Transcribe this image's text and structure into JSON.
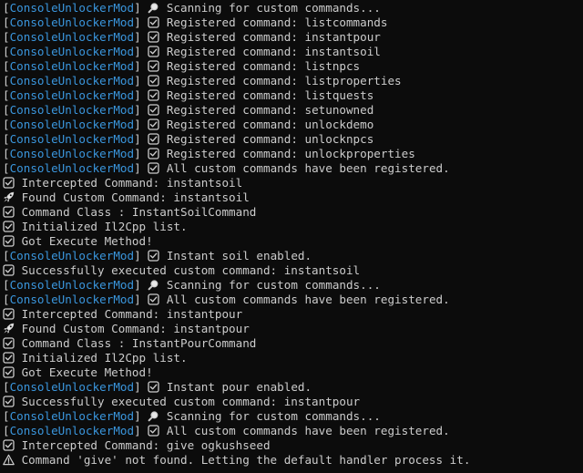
{
  "console": {
    "prefix": "ConsoleUnlockerMod",
    "colors": {
      "background": "#0c0c0c",
      "text": "#cccccc",
      "prefix": "#3a96dd"
    },
    "lines": [
      {
        "tagged": true,
        "icon": "magnifier-icon",
        "text": "Scanning for custom commands..."
      },
      {
        "tagged": true,
        "icon": "check-box-icon",
        "text": "Registered command: listcommands"
      },
      {
        "tagged": true,
        "icon": "check-box-icon",
        "text": "Registered command: instantpour"
      },
      {
        "tagged": true,
        "icon": "check-box-icon",
        "text": "Registered command: instantsoil"
      },
      {
        "tagged": true,
        "icon": "check-box-icon",
        "text": "Registered command: listnpcs"
      },
      {
        "tagged": true,
        "icon": "check-box-icon",
        "text": "Registered command: listproperties"
      },
      {
        "tagged": true,
        "icon": "check-box-icon",
        "text": "Registered command: listquests"
      },
      {
        "tagged": true,
        "icon": "check-box-icon",
        "text": "Registered command: setunowned"
      },
      {
        "tagged": true,
        "icon": "check-box-icon",
        "text": "Registered command: unlockdemo"
      },
      {
        "tagged": true,
        "icon": "check-box-icon",
        "text": "Registered command: unlocknpcs"
      },
      {
        "tagged": true,
        "icon": "check-box-icon",
        "text": "Registered command: unlockproperties"
      },
      {
        "tagged": true,
        "icon": "check-box-icon",
        "text": "All custom commands have been registered."
      },
      {
        "tagged": false,
        "icon": "check-box-icon",
        "text": "Intercepted Command: instantsoil"
      },
      {
        "tagged": false,
        "icon": "rocket-icon",
        "text": "Found Custom Command: instantsoil"
      },
      {
        "tagged": false,
        "icon": "check-box-icon",
        "text": "Command Class : InstantSoilCommand"
      },
      {
        "tagged": false,
        "icon": "check-box-icon",
        "text": "Initialized Il2Cpp list."
      },
      {
        "tagged": false,
        "icon": "check-box-icon",
        "text": "Got Execute Method!"
      },
      {
        "tagged": true,
        "icon": "check-box-icon",
        "text": "Instant soil enabled."
      },
      {
        "tagged": false,
        "icon": "check-box-icon",
        "text": "Successfully executed custom command: instantsoil"
      },
      {
        "tagged": true,
        "icon": "magnifier-icon",
        "text": "Scanning for custom commands..."
      },
      {
        "tagged": true,
        "icon": "check-box-icon",
        "text": "All custom commands have been registered."
      },
      {
        "tagged": false,
        "icon": "check-box-icon",
        "text": "Intercepted Command: instantpour"
      },
      {
        "tagged": false,
        "icon": "rocket-icon",
        "text": "Found Custom Command: instantpour"
      },
      {
        "tagged": false,
        "icon": "check-box-icon",
        "text": "Command Class : InstantPourCommand"
      },
      {
        "tagged": false,
        "icon": "check-box-icon",
        "text": "Initialized Il2Cpp list."
      },
      {
        "tagged": false,
        "icon": "check-box-icon",
        "text": "Got Execute Method!"
      },
      {
        "tagged": true,
        "icon": "check-box-icon",
        "text": "Instant pour enabled."
      },
      {
        "tagged": false,
        "icon": "check-box-icon",
        "text": "Successfully executed custom command: instantpour"
      },
      {
        "tagged": true,
        "icon": "magnifier-icon",
        "text": "Scanning for custom commands..."
      },
      {
        "tagged": true,
        "icon": "check-box-icon",
        "text": "All custom commands have been registered."
      },
      {
        "tagged": false,
        "icon": "check-box-icon",
        "text": "Intercepted Command: give ogkushseed"
      },
      {
        "tagged": false,
        "icon": "warning-icon",
        "text": "Command 'give' not found. Letting the default handler process it."
      }
    ]
  }
}
